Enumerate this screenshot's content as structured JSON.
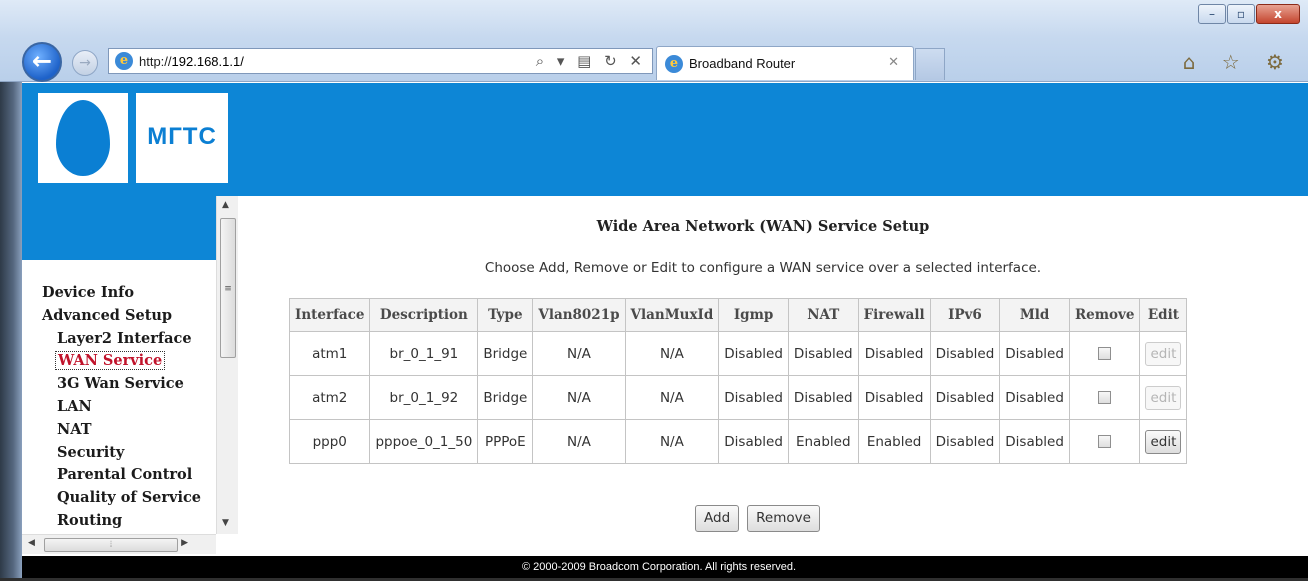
{
  "browser": {
    "address": "http://192.168.1.1/",
    "address_prefix": "http://",
    "address_host": "192.168.1.1/",
    "tab_title": "Broadband Router",
    "address_tools": "⌕ ▾ ▤ ↻ ✕",
    "tab_close": "✕",
    "right_icons": "⌂ ☆ ⚙",
    "window_buttons": {
      "minimize": "–",
      "maximize": "▫",
      "close": "x"
    }
  },
  "header": {
    "logo_text": "МГТС",
    "brand_color": "#0d86d6"
  },
  "sidebar": {
    "items": [
      {
        "label": "Device Info",
        "level": 0
      },
      {
        "label": "Advanced Setup",
        "level": 0
      },
      {
        "label": "Layer2 Interface",
        "level": 1
      },
      {
        "label": "WAN Service",
        "level": 1,
        "active": true
      },
      {
        "label": "3G Wan Service",
        "level": 1
      },
      {
        "label": "LAN",
        "level": 1
      },
      {
        "label": "NAT",
        "level": 1
      },
      {
        "label": "Security",
        "level": 1
      },
      {
        "label": "Parental Control",
        "level": 1
      },
      {
        "label": "Quality of Service",
        "level": 1
      },
      {
        "label": "Routing",
        "level": 1
      }
    ],
    "active_color": "#c0122a"
  },
  "main": {
    "title": "Wide Area Network (WAN) Service Setup",
    "instructions": "Choose Add, Remove or Edit to configure a WAN service over a selected interface.",
    "table": {
      "headers": [
        "Interface",
        "Description",
        "Type",
        "Vlan8021p",
        "VlanMuxId",
        "Igmp",
        "NAT",
        "Firewall",
        "IPv6",
        "Mld",
        "Remove",
        "Edit"
      ],
      "rows": [
        {
          "interface": "atm1",
          "description": "br_0_1_91",
          "type": "Bridge",
          "vlan8021p": "N/A",
          "vlanmuxid": "N/A",
          "igmp": "Disabled",
          "nat": "Disabled",
          "firewall": "Disabled",
          "ipv6": "Disabled",
          "mld": "Disabled",
          "remove_checked": false,
          "edit_label": "edit",
          "edit_enabled": false
        },
        {
          "interface": "atm2",
          "description": "br_0_1_92",
          "type": "Bridge",
          "vlan8021p": "N/A",
          "vlanmuxid": "N/A",
          "igmp": "Disabled",
          "nat": "Disabled",
          "firewall": "Disabled",
          "ipv6": "Disabled",
          "mld": "Disabled",
          "remove_checked": false,
          "edit_label": "edit",
          "edit_enabled": false
        },
        {
          "interface": "ppp0",
          "description": "pppoe_0_1_50",
          "type": "PPPoE",
          "vlan8021p": "N/A",
          "vlanmuxid": "N/A",
          "igmp": "Disabled",
          "nat": "Enabled",
          "firewall": "Enabled",
          "ipv6": "Disabled",
          "mld": "Disabled",
          "remove_checked": false,
          "edit_label": "edit",
          "edit_enabled": true
        }
      ]
    },
    "add_label": "Add",
    "remove_label": "Remove"
  },
  "footer": {
    "copyright": "© 2000-2009 Broadcom Corporation. All rights reserved."
  }
}
